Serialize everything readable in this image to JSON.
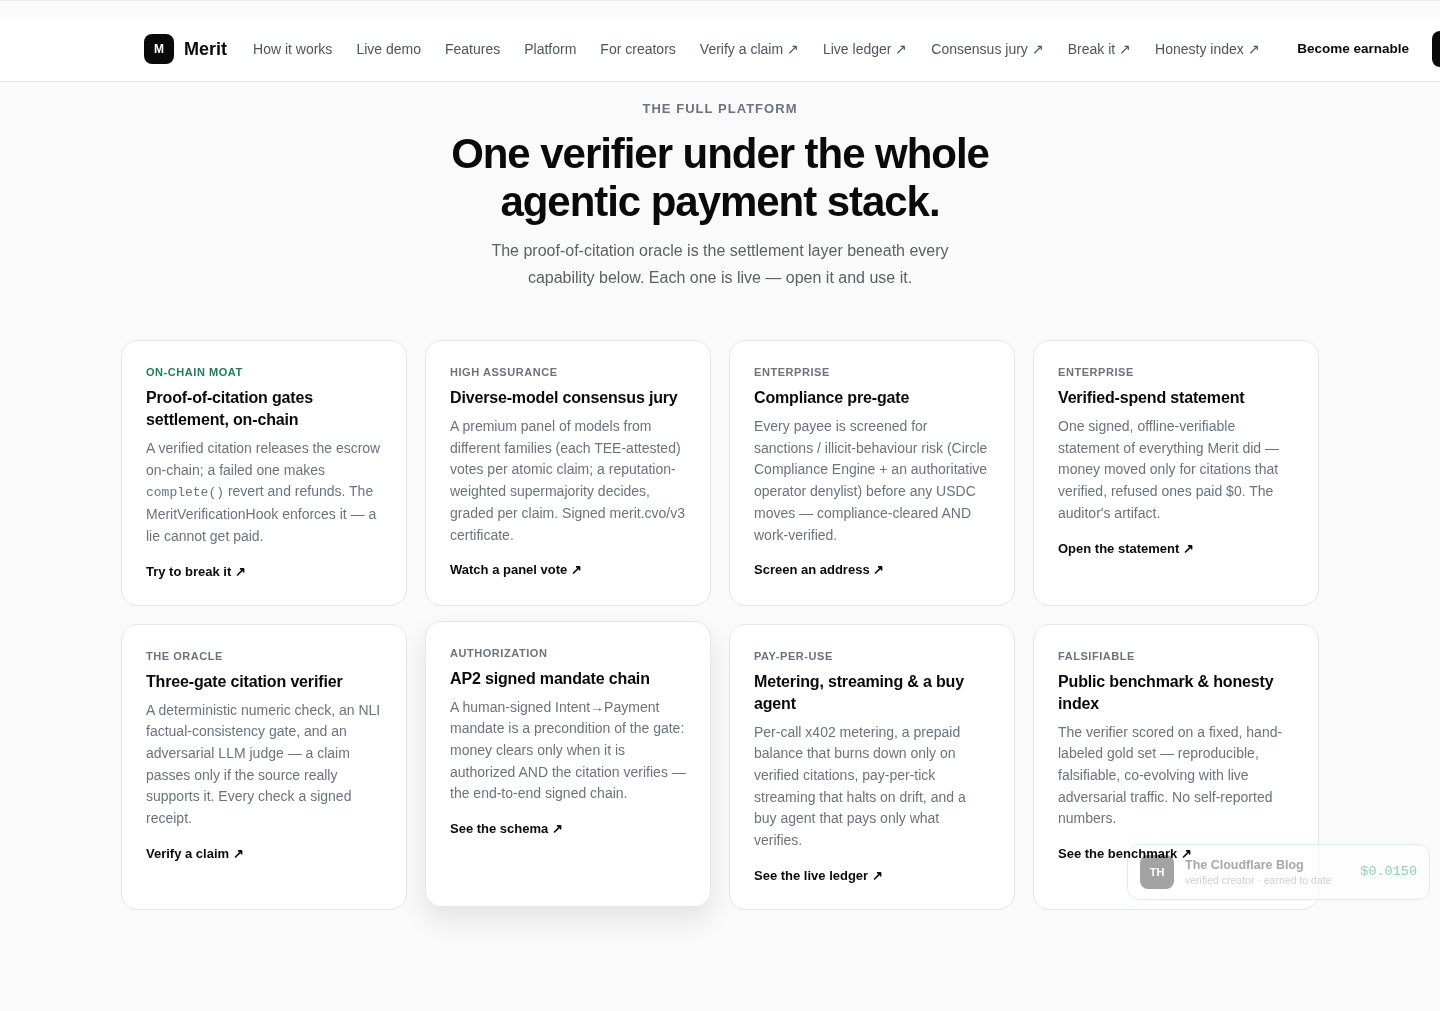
{
  "top_nav": {
    "logo_mark": "M",
    "brand": "Merit",
    "links": [
      {
        "label": "How it works"
      },
      {
        "label": "Live demo"
      },
      {
        "label": "Features"
      },
      {
        "label": "Platform"
      },
      {
        "label": "For creators"
      },
      {
        "label": "Verify a claim ↗"
      },
      {
        "label": "Live ledger ↗"
      },
      {
        "label": "Consensus jury ↗"
      },
      {
        "label": "Break it ↗"
      },
      {
        "label": "Honesty index ↗"
      }
    ],
    "cta": "Become earnable"
  },
  "section": {
    "eyebrow": "THE FULL PLATFORM",
    "heading": "One verifier under the whole agentic payment stack.",
    "subheading": "The proof-of-citation oracle is the settlement layer beneath every capability below. Each one is live — open it and use it."
  },
  "cards": [
    {
      "tag": {
        "text": "ON-CHAIN MOAT",
        "color": "#1a8059"
      },
      "title": "Proof-of-citation gates settlement, on-chain",
      "description": [
        {
          "kind": "text",
          "text": "A verified citation releases the escrow on-chain; a failed one makes "
        },
        {
          "kind": "code",
          "text": "complete()"
        },
        {
          "kind": "text",
          "text": " revert and refunds. The MeritVerificationHook enforces it — a lie cannot get paid."
        }
      ],
      "link": "Try to break it ↗",
      "raised": false
    },
    {
      "tag": {
        "text": "HIGH ASSURANCE",
        "color": "#6b7280"
      },
      "title": "Diverse-model consensus jury",
      "description": [
        {
          "kind": "text",
          "text": "A premium panel of models from different families (each TEE-attested) votes per atomic claim; a reputation-weighted supermajority decides, graded per claim. Signed merit.cvo/v3 certificate."
        }
      ],
      "link": "Watch a panel vote ↗",
      "raised": false
    },
    {
      "tag": {
        "text": "ENTERPRISE",
        "color": "#6b7280"
      },
      "title": "Compliance pre-gate",
      "description": [
        {
          "kind": "text",
          "text": "Every payee is screened for sanctions / illicit-behaviour risk (Circle Compliance Engine + an authoritative operator denylist) before any USDC moves — compliance-cleared AND work-verified."
        }
      ],
      "link": "Screen an address ↗",
      "raised": false
    },
    {
      "tag": {
        "text": "ENTERPRISE",
        "color": "#6b7280"
      },
      "title": "Verified-spend statement",
      "description": [
        {
          "kind": "text",
          "text": "One signed, offline-verifiable statement of everything Merit did — money moved only for citations that verified, refused ones paid $0. The auditor's artifact."
        }
      ],
      "link": "Open the statement ↗",
      "raised": false
    },
    {
      "tag": {
        "text": "THE ORACLE",
        "color": "#6b7280"
      },
      "title": "Three-gate citation verifier",
      "description": [
        {
          "kind": "text",
          "text": "A deterministic numeric check, an NLI factual-consistency gate, and an adversarial LLM judge — a claim passes only if the source really supports it. Every check a signed receipt."
        }
      ],
      "link": "Verify a claim ↗",
      "raised": false
    },
    {
      "tag": {
        "text": "AUTHORIZATION",
        "color": "#6b7280"
      },
      "title": "AP2 signed mandate chain",
      "description": [
        {
          "kind": "text",
          "text": "A human-signed Intent→Payment mandate is a precondition of the gate: money clears only when it is authorized AND the citation verifies — the end-to-end signed chain."
        }
      ],
      "link": "See the schema ↗",
      "raised": true
    },
    {
      "tag": {
        "text": "PAY-PER-USE",
        "color": "#6b7280"
      },
      "title": "Metering, streaming & a buy agent",
      "description": [
        {
          "kind": "text",
          "text": "Per-call x402 metering, a prepaid balance that burns down only on verified citations, pay-per-tick streaming that halts on drift, and a buy agent that pays only what verifies."
        }
      ],
      "link": "See the live ledger ↗",
      "raised": false
    },
    {
      "tag": {
        "text": "FALSIFIABLE",
        "color": "#6b7280"
      },
      "title": "Public benchmark & honesty index",
      "description": [
        {
          "kind": "text",
          "text": "The verifier scored on a fixed, hand-labeled gold set — reproducible, falsifiable, co-evolving with live adversarial traffic. No self-reported numbers."
        }
      ],
      "link": "See the benchmark ↗",
      "raised": false
    }
  ],
  "toast": {
    "avatar_initials": "TH",
    "name": "The Cloudflare Blog",
    "caption": "verified creator · earned to date",
    "amount": "$0.0150"
  }
}
